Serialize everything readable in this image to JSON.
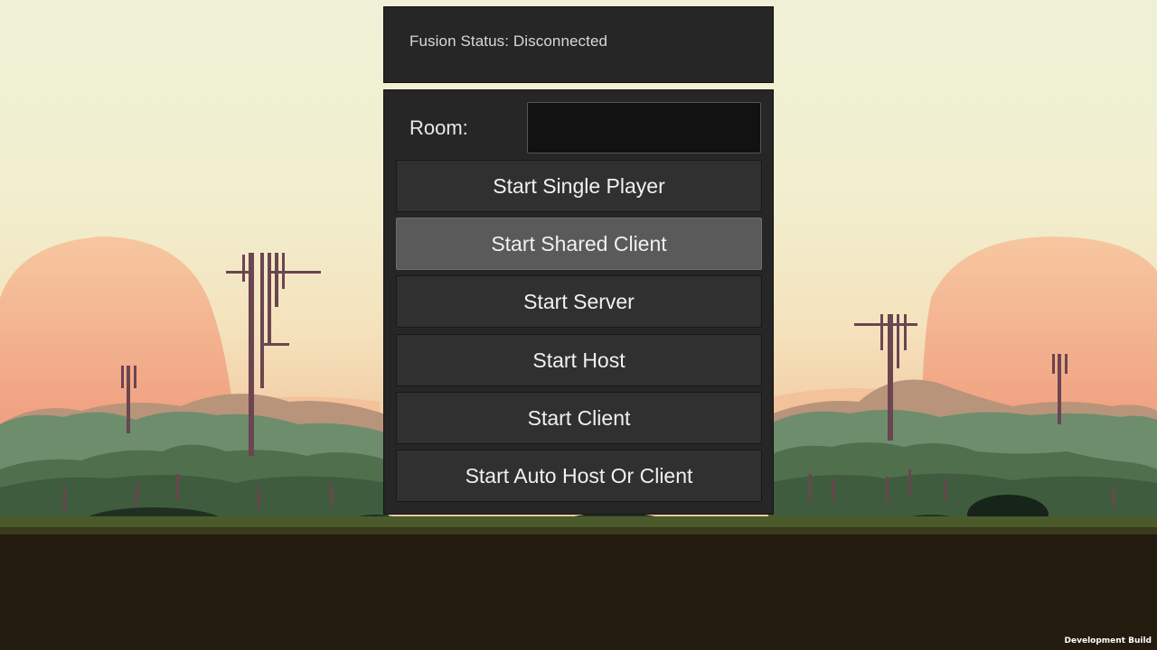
{
  "status": {
    "text": "Fusion Status: Disconnected"
  },
  "room": {
    "label": "Room:",
    "value": ""
  },
  "buttons": {
    "single_player": "Start Single Player",
    "shared_client": "Start Shared Client",
    "server": "Start Server",
    "host": "Start Host",
    "client": "Start Client",
    "auto_host_or_client": "Start Auto Host Or Client"
  },
  "hovered_button": "shared_client",
  "footer": {
    "build_label": "Development Build"
  },
  "colors": {
    "panel_bg": "#262626",
    "button_bg": "#303030",
    "button_hover_bg": "#5a5a5a",
    "input_bg": "#121212",
    "sky_top": "#efefd2",
    "sun_blob": "#f5b590",
    "ground": "#241c0e"
  }
}
